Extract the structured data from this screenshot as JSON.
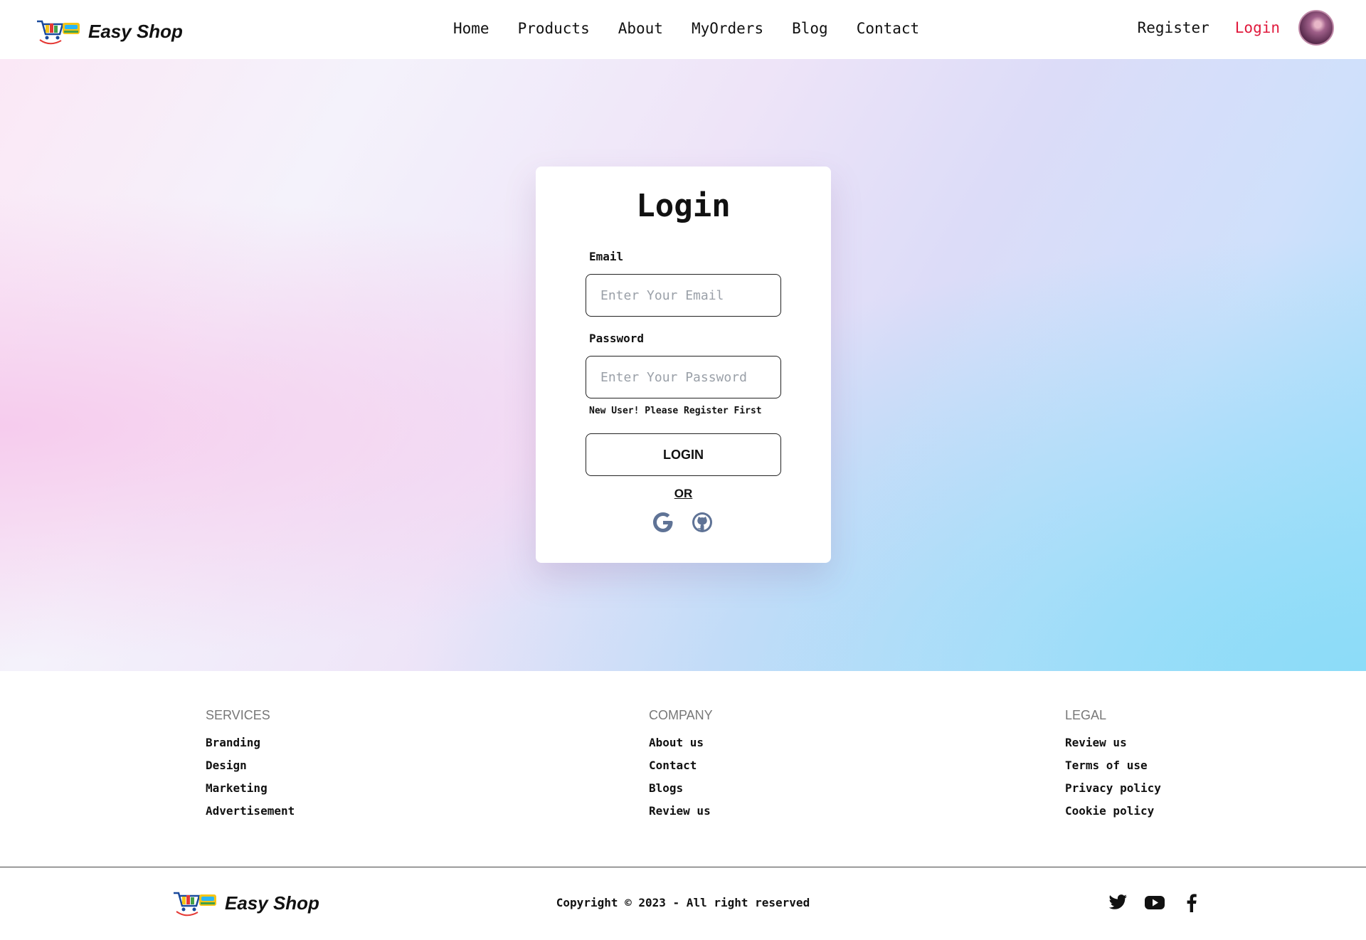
{
  "brand": {
    "name": "Easy Shop"
  },
  "nav": {
    "links": [
      "Home",
      "Products",
      "About",
      "MyOrders",
      "Blog",
      "Contact"
    ],
    "register": "Register",
    "login": "Login"
  },
  "login_card": {
    "title": "Login",
    "email_label": "Email",
    "email_placeholder": "Enter Your Email",
    "password_label": "Password",
    "password_placeholder": "Enter Your Password",
    "register_hint": "New User! Please Register First",
    "login_button": "LOGIN",
    "or_text": "OR",
    "social_icons": [
      "google-icon",
      "github-icon"
    ]
  },
  "footer": {
    "services": {
      "heading": "SERVICES",
      "links": [
        "Branding",
        "Design",
        "Marketing",
        "Advertisement"
      ]
    },
    "company": {
      "heading": "COMPANY",
      "links": [
        "About us",
        "Contact",
        "Blogs",
        "Review us"
      ]
    },
    "legal": {
      "heading": "LEGAL",
      "links": [
        "Review us",
        "Terms of use",
        "Privacy policy",
        "Cookie policy"
      ]
    },
    "copyright": "Copyright © 2023 - All right reserved",
    "social_icons": [
      "twitter-icon",
      "youtube-icon",
      "facebook-icon"
    ]
  },
  "colors": {
    "accent": "#e0193c",
    "social_icon": "#5f7396"
  }
}
